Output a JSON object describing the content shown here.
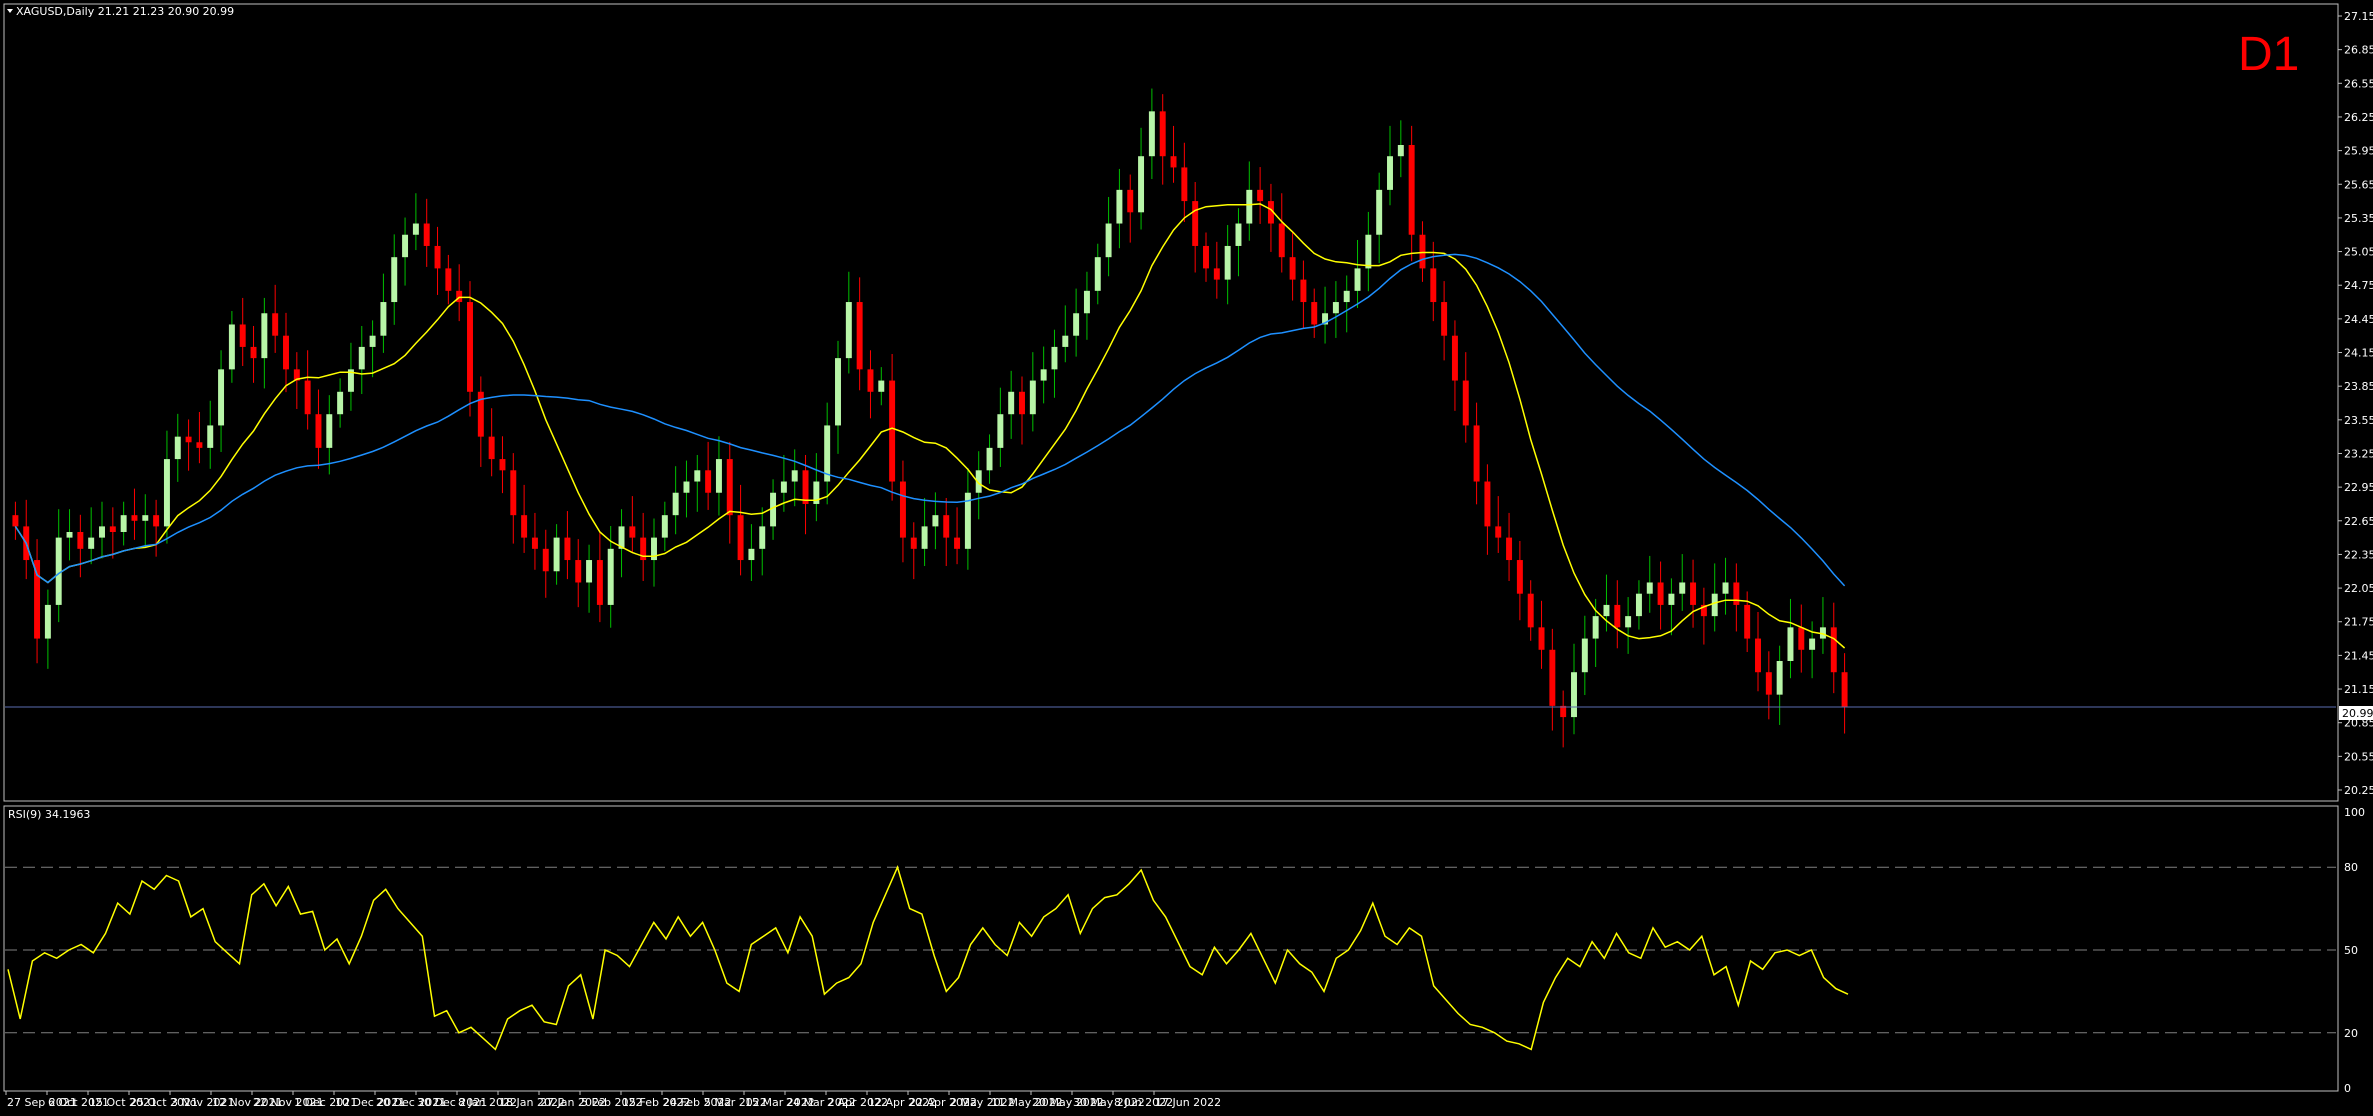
{
  "header": {
    "symbol_line": "XAGUSD,Daily  21.21 21.23 20.90 20.99",
    "timeframe": "D1",
    "rsi_label": "RSI(9) 34.1963",
    "last_price": "20.99"
  },
  "colors": {
    "background": "#000000",
    "bull": "#b8f5a8",
    "bear": "#ff0000",
    "wick_bull": "#00c000",
    "ma_fast": "#ffff00",
    "ma_slow": "#1e90ff",
    "rsi": "#ffff00",
    "grid_dash": "#808080",
    "price_line": "#5a6cb0"
  },
  "chart_data": [
    {
      "type": "candlestick",
      "title": "XAGUSD,Daily",
      "ylim": [
        20.25,
        27.15
      ],
      "y_ticks": [
        "27.15",
        "26.85",
        "26.55",
        "26.25",
        "25.95",
        "25.65",
        "25.35",
        "25.05",
        "24.75",
        "24.45",
        "24.15",
        "23.85",
        "23.55",
        "23.25",
        "22.95",
        "22.65",
        "22.35",
        "22.05",
        "21.75",
        "21.45",
        "21.15",
        "20.85",
        "20.55",
        "20.25"
      ],
      "x_tick_labels": [
        "27 Sep 2021",
        "6 Oct 2021",
        "15 Oct 2021",
        "25 Oct 2021",
        "3 Nov 2021",
        "12 Nov 2021",
        "22 Nov 2021",
        "1 Dec 2021",
        "10 Dec 2021",
        "20 Dec 2021",
        "30 Dec 2021",
        "8 Jan 2022",
        "18 Jan 2022",
        "27 Jan 2022",
        "5 Feb 2022",
        "15 Feb 2022",
        "24 Feb 2022",
        "5 Mar 2022",
        "15 Mar 2022",
        "24 Mar 2022",
        "2 Apr 2022",
        "12 Apr 2022",
        "22 Apr 2022",
        "2 May 2022",
        "11 May 2022",
        "20 May 2022",
        "30 May 2022",
        "8 Jun 2022",
        "17 Jun 2022"
      ],
      "last_price": 20.99,
      "close_series": [
        22.6,
        22.3,
        21.6,
        21.9,
        22.5,
        22.55,
        22.4,
        22.5,
        22.6,
        22.55,
        22.7,
        22.65,
        22.7,
        22.6,
        23.2,
        23.4,
        23.35,
        23.3,
        23.5,
        24.0,
        24.4,
        24.2,
        24.1,
        24.5,
        24.3,
        24.0,
        23.9,
        23.6,
        23.3,
        23.6,
        23.8,
        24.0,
        24.2,
        24.3,
        24.6,
        25.0,
        25.2,
        25.3,
        25.1,
        24.9,
        24.7,
        24.6,
        23.8,
        23.4,
        23.2,
        23.1,
        22.7,
        22.5,
        22.4,
        22.2,
        22.5,
        22.3,
        22.1,
        22.3,
        21.9,
        22.4,
        22.6,
        22.5,
        22.3,
        22.5,
        22.7,
        22.9,
        23.0,
        23.1,
        22.9,
        23.2,
        22.7,
        22.3,
        22.4,
        22.6,
        22.9,
        23.0,
        23.1,
        22.8,
        23.0,
        23.5,
        24.1,
        24.6,
        24.0,
        23.8,
        23.9,
        23.0,
        22.5,
        22.4,
        22.6,
        22.7,
        22.5,
        22.4,
        22.9,
        23.1,
        23.3,
        23.6,
        23.8,
        23.6,
        23.9,
        24.0,
        24.2,
        24.3,
        24.5,
        24.7,
        25.0,
        25.3,
        25.6,
        25.4,
        25.9,
        26.3,
        25.9,
        25.8,
        25.5,
        25.1,
        24.9,
        24.8,
        25.1,
        25.3,
        25.6,
        25.5,
        25.3,
        25.0,
        24.8,
        24.6,
        24.4,
        24.5,
        24.6,
        24.7,
        24.9,
        25.2,
        25.6,
        25.9,
        26.0,
        25.2,
        24.9,
        24.6,
        24.3,
        23.9,
        23.5,
        23.0,
        22.6,
        22.5,
        22.3,
        22.0,
        21.7,
        21.5,
        21.0,
        20.9,
        21.3,
        21.6,
        21.8,
        21.9,
        21.7,
        21.8,
        22.0,
        22.1,
        21.9,
        22.0,
        22.1,
        21.9,
        21.8,
        22.0,
        22.1,
        21.9,
        21.6,
        21.3,
        21.1,
        21.4,
        21.7,
        21.5,
        21.6,
        21.7,
        21.3,
        20.99
      ],
      "series": [
        {
          "name": "MA fast",
          "color": "#ffff00"
        },
        {
          "name": "MA slow",
          "color": "#1e90ff"
        }
      ]
    },
    {
      "type": "line",
      "title": "RSI(9) 34.1963",
      "ylim": [
        0,
        100
      ],
      "y_ticks": [
        "100",
        "80",
        "50",
        "20",
        "0"
      ],
      "levels": [
        80,
        50,
        20
      ],
      "series": [
        {
          "name": "RSI(9)",
          "values": [
            43,
            25,
            46,
            49,
            47,
            50,
            52,
            49,
            56,
            67,
            63,
            75,
            72,
            77,
            75,
            62,
            65,
            53,
            49,
            45,
            70,
            74,
            66,
            73,
            63,
            64,
            50,
            54,
            45,
            55,
            68,
            72,
            65,
            60,
            55,
            26,
            28,
            20,
            22,
            18,
            14,
            25,
            28,
            30,
            24,
            23,
            37,
            41,
            25,
            50,
            48,
            44,
            52,
            60,
            54,
            62,
            55,
            60,
            50,
            38,
            35,
            52,
            55,
            58,
            49,
            62,
            55,
            34,
            38,
            40,
            45,
            60,
            70,
            80,
            65,
            63,
            48,
            35,
            40,
            52,
            58,
            52,
            48,
            60,
            55,
            62,
            65,
            70,
            56,
            65,
            69,
            70,
            74,
            79,
            68,
            62,
            53,
            44,
            41,
            51,
            45,
            50,
            56,
            47,
            38,
            50,
            45,
            42,
            35,
            47,
            50,
            57,
            67,
            55,
            52,
            58,
            55,
            37,
            32,
            27,
            23,
            22,
            20,
            17,
            16,
            14,
            31,
            40,
            47,
            44,
            53,
            47,
            56,
            49,
            47,
            58,
            51,
            53,
            50,
            55,
            41,
            44,
            30,
            46,
            43,
            49,
            50,
            48,
            50,
            40,
            36,
            34
          ]
        }
      ]
    }
  ]
}
